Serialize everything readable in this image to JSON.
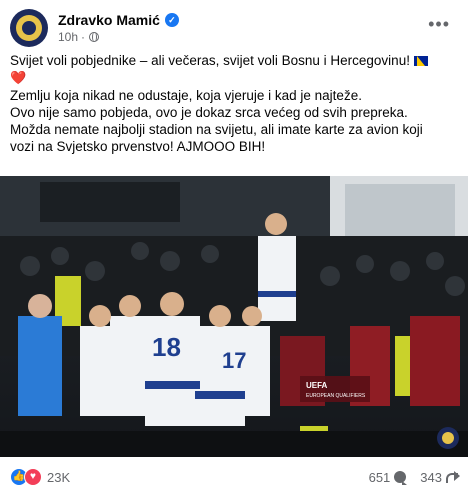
{
  "post": {
    "author": "Zdravko Mamić",
    "time": "10h",
    "time_separator": "·",
    "more_label": "•••",
    "lines": [
      "Svijet voli pobjednike – ali večeras, svijet voli Bosnu i Hercegovinu!",
      "Zemlju koja nikad ne odustaje, koja vjeruje i kad je najteže.",
      "Ovo nije samo pobjeda, ovo je dokaz srca većeg od svih prepreka.",
      "Možda nemate najbolji stadion na svijetu, ali imate karte za avion koji",
      "vozi na Svjetsko prvenstvo! AJMOOO BIH!"
    ],
    "heart": "❤️",
    "photo": {
      "player_numbers": [
        "18",
        "17"
      ],
      "banner_text": "UEFA",
      "banner_text2": "EUROPEAN QUALIFIERS"
    }
  },
  "footer": {
    "reactions_count": "23K",
    "comments_count": "651",
    "shares_count": "343",
    "like_glyph": "👍",
    "love_glyph": "♥"
  },
  "colors": {
    "facebook_blue": "#1877f2",
    "love_red": "#f33e58",
    "secondary_text": "#65676b"
  },
  "icons": [
    "verified-badge-icon",
    "globe-icon",
    "more-options-icon",
    "bosnia-flag-icon",
    "red-heart-icon",
    "like-reaction-icon",
    "love-reaction-icon",
    "comment-icon",
    "share-icon"
  ]
}
